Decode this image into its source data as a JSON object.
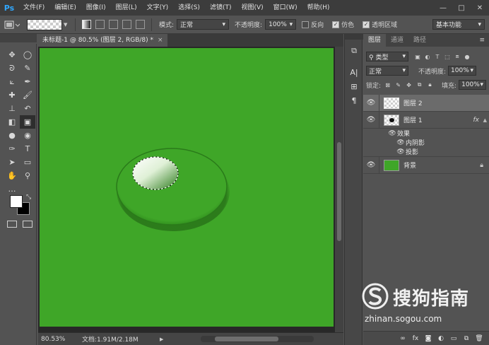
{
  "app": {
    "logo": "Ps"
  },
  "menu": [
    "文件(F)",
    "编辑(E)",
    "图像(I)",
    "图层(L)",
    "文字(Y)",
    "选择(S)",
    "滤镜(T)",
    "视图(V)",
    "窗口(W)",
    "帮助(H)"
  ],
  "window_controls": {
    "minimize": "—",
    "maximize": "□",
    "close": "✕"
  },
  "options": {
    "mode_label": "模式:",
    "mode_value": "正常",
    "opacity_label": "不透明度:",
    "opacity_value": "100%",
    "reverse_label": "反向",
    "reverse_checked": false,
    "dither_label": "仿色",
    "dither_checked": true,
    "transparency_label": "透明区域",
    "transparency_checked": true,
    "workspace": "基本功能"
  },
  "document": {
    "tab_title": "未标题-1 @ 80.5% (图层 2, RGB/8) *",
    "close": "×",
    "canvas_color": "#3fa628"
  },
  "status": {
    "zoom": "80.53%",
    "doc_info": "文档:1.91M/2.18M"
  },
  "tools": [
    "move-tool",
    "marquee-tool",
    "lasso-tool",
    "quick-select-tool",
    "crop-tool",
    "eyedropper-tool",
    "healing-brush-tool",
    "brush-tool",
    "clone-stamp-tool",
    "history-brush-tool",
    "eraser-tool",
    "gradient-tool",
    "blur-tool",
    "dodge-tool",
    "pen-tool",
    "type-tool",
    "path-select-tool",
    "shape-tool",
    "hand-tool",
    "zoom-tool"
  ],
  "tool_glyphs": [
    "✥",
    "◯",
    "ᘐ",
    "✎",
    "⟀",
    "✒",
    "✚",
    "🖌",
    "⊥",
    "↶",
    "◧",
    "▣",
    "●",
    "◉",
    "✑",
    "T",
    "➤",
    "▭",
    "✋",
    "⚲"
  ],
  "colors": {
    "foreground": "#ffffff",
    "background": "#000000"
  },
  "layers_panel": {
    "tabs": [
      "图层",
      "通道",
      "路径"
    ],
    "filter_kind": "类型",
    "blend_mode": "正常",
    "opacity_label": "不透明度:",
    "opacity_value": "100%",
    "lock_label": "锁定:",
    "fill_label": "填充:",
    "fill_value": "100%",
    "layers": [
      {
        "name": "图层 2",
        "selected": true
      },
      {
        "name": "图层 1",
        "fx": "fx",
        "effects_label": "效果",
        "effects": [
          "内阴影",
          "投影"
        ]
      },
      {
        "name": "背景",
        "locked": true
      }
    ]
  },
  "watermark": {
    "brand": "搜狗指南",
    "url": "zhinan.sogou.com"
  }
}
